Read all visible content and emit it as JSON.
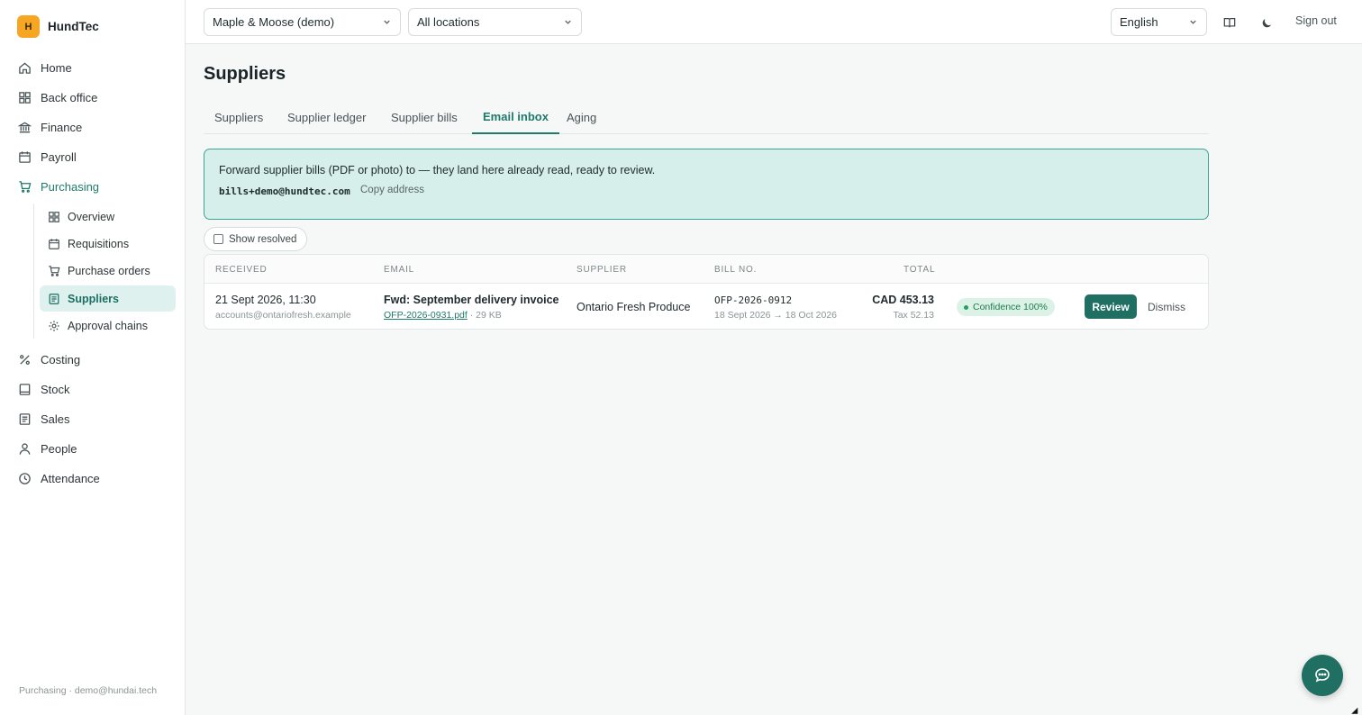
{
  "brand": {
    "logo_letter": "H",
    "name": "HundTec"
  },
  "sidebar": {
    "items": [
      {
        "label": "Home",
        "icon": "home-icon"
      },
      {
        "label": "Back office",
        "icon": "grid-icon"
      },
      {
        "label": "Finance",
        "icon": "bank-icon"
      },
      {
        "label": "Payroll",
        "icon": "calendar-icon"
      },
      {
        "label": "Purchasing",
        "icon": "cart-icon",
        "active": true
      }
    ],
    "sub_items": [
      {
        "label": "Overview",
        "icon": "grid-icon"
      },
      {
        "label": "Requisitions",
        "icon": "calendar-icon"
      },
      {
        "label": "Purchase orders",
        "icon": "cart-icon"
      },
      {
        "label": "Suppliers",
        "icon": "list-icon",
        "active": true
      },
      {
        "label": "Approval chains",
        "icon": "gear-icon"
      }
    ],
    "items_after": [
      {
        "label": "Costing",
        "icon": "percent-icon"
      },
      {
        "label": "Stock",
        "icon": "box-icon"
      },
      {
        "label": "Sales",
        "icon": "list-icon"
      },
      {
        "label": "People",
        "icon": "person-icon"
      },
      {
        "label": "Attendance",
        "icon": "clock-icon"
      }
    ],
    "footer": "Purchasing · demo@hundai.tech"
  },
  "topbar": {
    "company_select": "Maple & Moose (demo)",
    "location_select": "All locations",
    "language_select": "English",
    "sign_out": "Sign out"
  },
  "page": {
    "title": "Suppliers",
    "tabs": [
      "Suppliers",
      "Supplier ledger",
      "Supplier bills",
      "Email inbox",
      "Aging"
    ],
    "active_tab": "Email inbox"
  },
  "banner": {
    "text": "Forward supplier bills (PDF or photo) to — they land here already read, ready to review.",
    "email": "bills+demo@hundtec.com",
    "copy_label": "Copy address"
  },
  "filter": {
    "show_resolved_label": "Show resolved",
    "checked": false
  },
  "table": {
    "headers": [
      "RECEIVED",
      "EMAIL",
      "SUPPLIER",
      "BILL NO.",
      "TOTAL"
    ],
    "rows": [
      {
        "received": "21 Sept 2026, 11:30",
        "from": "accounts@ontariofresh.example",
        "subject": "Fwd: September delivery invoice",
        "attachment": "OFP-2026-0931.pdf",
        "attachment_size": "· 29 KB",
        "supplier": "Ontario Fresh Produce",
        "bill_no": "OFP-2026-0912",
        "bill_dates": "18 Sept 2026 → 18 Oct 2026",
        "total": "CAD 453.13",
        "tax": "Tax 52.13",
        "confidence": "Confidence 100%",
        "review_label": "Review",
        "dismiss_label": "Dismiss"
      }
    ]
  },
  "colors": {
    "accent": "#1f6f63",
    "brand_logo": "#f6a623",
    "banner_bg": "#d6efea"
  }
}
